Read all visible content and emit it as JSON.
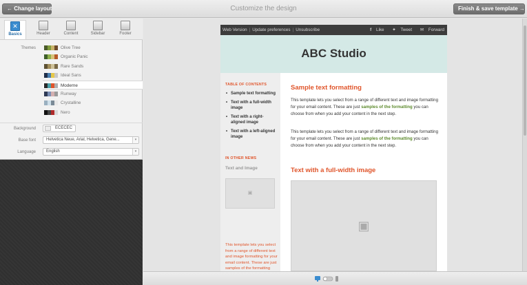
{
  "topbar": {
    "back_label": "← Change layout",
    "title": "Customize the design",
    "finish_label": "Finish & save template →"
  },
  "tabs": [
    {
      "label": "Basics",
      "active": true
    },
    {
      "label": "Header",
      "active": false
    },
    {
      "label": "Content",
      "active": false
    },
    {
      "label": "Sidebar",
      "active": false
    },
    {
      "label": "Footer",
      "active": false
    }
  ],
  "themes_label": "Themes",
  "themes": [
    {
      "name": "Olive Tree",
      "colors": [
        "#4a5a2a",
        "#7f9b3b",
        "#c9b36a",
        "#6e4a2a"
      ]
    },
    {
      "name": "Organic Panic",
      "colors": [
        "#3f5f2a",
        "#8fb04a",
        "#d8c27a",
        "#b65a2a"
      ]
    },
    {
      "name": "Rare Sands",
      "colors": [
        "#5e5234",
        "#a38f5c",
        "#cfc29a",
        "#7a6a48"
      ]
    },
    {
      "name": "Ideal Sans",
      "colors": [
        "#1f2f4a",
        "#4a7fb0",
        "#e6c84a",
        "#c8c8c8"
      ]
    },
    {
      "name": "Moderne",
      "colors": [
        "#2a2a2a",
        "#4aa0a8",
        "#e0552b",
        "#b0b0b0"
      ],
      "active": true
    },
    {
      "name": "Runway",
      "colors": [
        "#2f3a55",
        "#7b8fb5",
        "#d4b0b0",
        "#9a9a9a"
      ]
    },
    {
      "name": "Crystalline",
      "colors": [
        "#9ab0c0",
        "#cfe0ea",
        "#7a8a96",
        "#e8e8e8"
      ]
    },
    {
      "name": "Nero",
      "colors": [
        "#111111",
        "#444444",
        "#b02a2a",
        "#d8d8d8"
      ]
    }
  ],
  "background_label": "Background",
  "background_value": "ECECEC",
  "base_font_label": "Base font",
  "base_font_value": "Helvetica Neue, Arial, Helvetica, Gene...",
  "language_label": "Language",
  "language_value": "English",
  "email": {
    "links": [
      "Web Version",
      "Update preferences",
      "Unsubscribe"
    ],
    "social": [
      "Like",
      "Tweet",
      "Forward"
    ],
    "brand": "ABC Studio",
    "toc_title": "TABLE OF CONTENTS",
    "toc": [
      "Sample text formatting",
      "Text with a full-width image",
      "Text with a right-aligned image",
      "Text with a left-aligned image"
    ],
    "news_heading": "IN OTHER NEWS",
    "news_title": "Text and Image",
    "side_text": "This template lets you select from a range of different text and image formatting for your email content. These are just samples of the formatting you can choose from when you add your content in the next step.",
    "h_sample": "Sample text formatting",
    "p1_a": "This template lets you select from a range of different text and image formatting for your email content. These are just ",
    "p1_hl": "samples of the formatting",
    "p1_b": " you can choose from when you add your content in the next step.",
    "p2_a": "This template lets you select from a range of different text and image formatting for your email content. These are just ",
    "p2_hl": "samples of the formatting",
    "p2_b": " you can choose from when you add your content in the next step.",
    "h_fullwidth": "Text with a full-width image"
  }
}
